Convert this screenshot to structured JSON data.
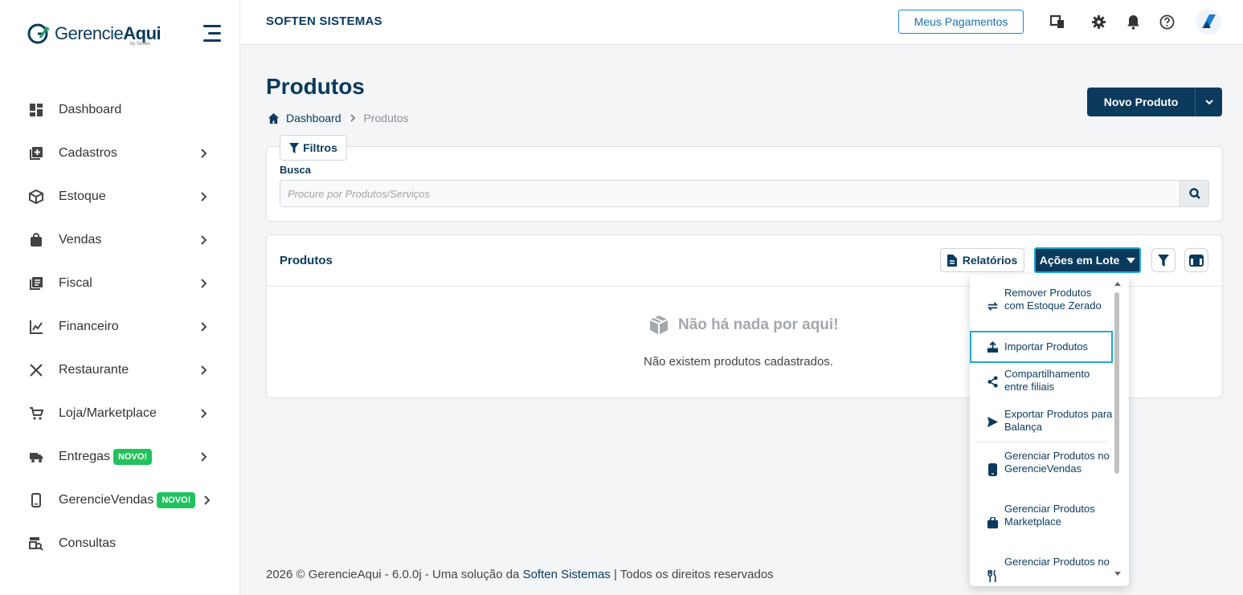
{
  "app": {
    "logo_text_light": "Gerencie",
    "logo_text_bold": "Aqui",
    "logo_sub": "by Soften",
    "company": "SOFTEN SISTEMAS"
  },
  "topbar": {
    "pay_button": "Meus Pagamentos",
    "icons": [
      "screens-icon",
      "gear-icon",
      "bell-icon",
      "help-icon"
    ]
  },
  "sidebar": {
    "items": [
      {
        "label": "Dashboard",
        "icon": "dashboard-icon",
        "chevron": false
      },
      {
        "label": "Cadastros",
        "icon": "add-box-icon",
        "chevron": true
      },
      {
        "label": "Estoque",
        "icon": "box-icon",
        "chevron": true
      },
      {
        "label": "Vendas",
        "icon": "shopping-bag-icon",
        "chevron": true
      },
      {
        "label": "Fiscal",
        "icon": "document-list-icon",
        "chevron": true
      },
      {
        "label": "Financeiro",
        "icon": "chart-icon",
        "chevron": true
      },
      {
        "label": "Restaurante",
        "icon": "cutlery-icon",
        "chevron": true
      },
      {
        "label": "Loja/Marketplace",
        "icon": "cart-icon",
        "chevron": true
      },
      {
        "label": "Entregas",
        "icon": "truck-icon",
        "chevron": true,
        "badge": "NOVO!"
      },
      {
        "label": "GerencieVendas",
        "icon": "phone-icon",
        "chevron": true,
        "badge": "NOVO!"
      },
      {
        "label": "Consultas",
        "icon": "search-doc-icon",
        "chevron": false
      }
    ]
  },
  "main": {
    "title": "Produtos",
    "breadcrumb": {
      "home": "Dashboard",
      "current": "Produtos"
    },
    "new_button": "Novo Produto",
    "filters": {
      "tab": "Filtros",
      "search_label": "Busca",
      "search_placeholder": "Procure por Produtos/Serviços"
    },
    "products_card": {
      "title": "Produtos",
      "reports_button": "Relatórios",
      "batch_button": "Ações em Lote",
      "empty_title": "Não há nada por aqui!",
      "empty_desc": "Não existem produtos cadastrados."
    }
  },
  "dropdown": {
    "items": [
      "Remover Produtos com Estoque Zerado",
      "Importar Produtos",
      "Compartilhamento entre filiais",
      "Exportar Produtos para Balança",
      "Gerenciar Produtos no GerencieVendas",
      "Gerenciar Produtos Marketplace",
      "Gerenciar Produtos no"
    ]
  },
  "footer": {
    "prefix": "2026 © GerencieAqui - 6.0.0j - Uma solução da ",
    "link": "Soften Sistemas",
    "suffix": " | Todos os direitos reservados"
  },
  "colors": {
    "primary": "#0b3a5c",
    "accent": "#1fa8d4",
    "badge": "#21c25e"
  }
}
